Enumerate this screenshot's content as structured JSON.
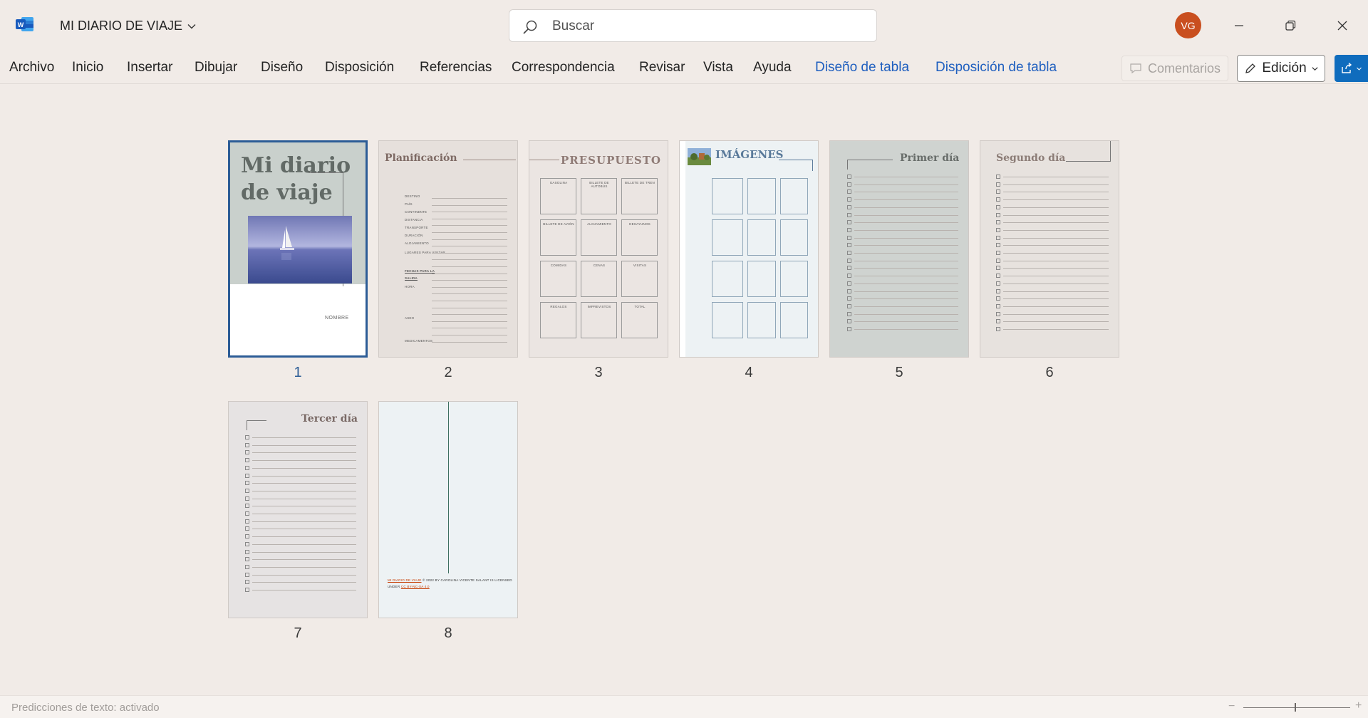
{
  "titlebar": {
    "doc_title": "MI DIARIO DE VIAJE",
    "search_placeholder": "Buscar",
    "avatar_initials": "VG"
  },
  "ribbon": {
    "tabs": [
      "Archivo",
      "Inicio",
      "Insertar",
      "Dibujar",
      "Diseño",
      "Disposición",
      "Referencias",
      "Correspondencia",
      "Revisar",
      "Vista",
      "Ayuda",
      "Diseño de tabla",
      "Disposición de tabla"
    ],
    "comments_label": "Comentarios",
    "edit_label": "Edición"
  },
  "pages": {
    "p1": {
      "number": "1",
      "title_line1": "Mi diario",
      "title_line2": "de viaje",
      "name_label": "NOMBRE"
    },
    "p2": {
      "number": "2",
      "title": "Planificación",
      "fields": [
        "DESTINO",
        "PAÍS",
        "CONTINENTE",
        "DISTANCIA",
        "TRANSPORTE",
        "DURACIÓN",
        "ALOJAMIENTO",
        "LUGARES PARA VISITAR",
        "FECHAS PARA LA",
        "SALIDA",
        "HORA",
        "ASEO",
        "MEDICAMENTOS"
      ]
    },
    "p3": {
      "number": "3",
      "title": "PRESUPUESTO",
      "cells": [
        "GASOLINA",
        "BILLETE DE AUTOBÚS",
        "BILLETE DE TREN",
        "BILLETE DE AVIÓN",
        "ALOJAMIENTO",
        "DESAYUNOS",
        "COMIDAS",
        "CENAS",
        "VISITAS",
        "REGALOS",
        "IMPREVISTOS",
        "TOTAL"
      ]
    },
    "p4": {
      "number": "4",
      "title": "IMÁGENES"
    },
    "p5": {
      "number": "5",
      "title": "Primer día"
    },
    "p6": {
      "number": "6",
      "title": "Segundo día"
    },
    "p7": {
      "number": "7",
      "title": "Tercer día"
    },
    "p8": {
      "number": "8",
      "footer_link": "MI DIARIO DE VIAJE",
      "footer_text": "© 2022 BY CAROLINA VICENTE SALANT IS LICENSED UNDER",
      "footer_link2": "CC BY-NC-SA 4.0"
    }
  },
  "statusbar": {
    "predictions": "Predicciones de texto: activado",
    "zoom_minus": "−",
    "zoom_plus": "+"
  },
  "colors": {
    "accent_blue": "#0f6cbd",
    "avatar_orange": "#c94f1f",
    "selected_border": "#2c5c96",
    "contextual_tab_blue": "#1f5fbf"
  }
}
